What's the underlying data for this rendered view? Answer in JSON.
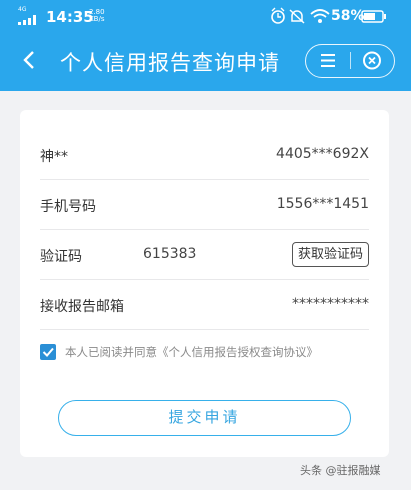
{
  "status_bar": {
    "network": "4G",
    "time": "14:35",
    "speed_value": "2.80",
    "speed_unit": "KB/s",
    "battery": "58%"
  },
  "header": {
    "title": "个人信用报告查询申请",
    "back_icon": "chevron-left-icon",
    "menu_icon": "menu-icon",
    "close_icon": "close-circle-icon",
    "accent": "#2aa7ec"
  },
  "form": {
    "rows": [
      {
        "label": "神**",
        "value": "4405***692X"
      },
      {
        "label": "手机号码",
        "value": "1556***1451"
      },
      {
        "label": "验证码",
        "value": "615383",
        "button": "获取验证码"
      },
      {
        "label": "接收报告邮箱",
        "value": "***********"
      }
    ],
    "agreement": {
      "checked": true,
      "text": "本人已阅读并同意《个人信用报告授权查询协议》"
    },
    "submit_label": "提交申请"
  },
  "watermark": "头条 @驻报融媒"
}
